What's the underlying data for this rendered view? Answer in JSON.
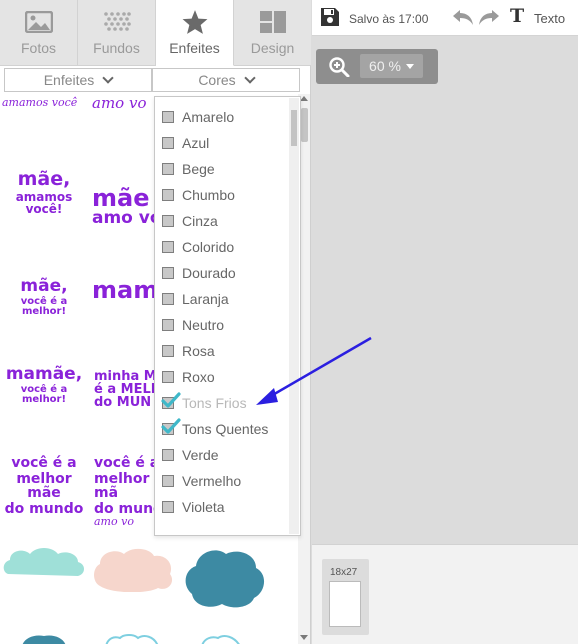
{
  "tabs": [
    {
      "label": "Fotos",
      "icon": "image-icon"
    },
    {
      "label": "Fundos",
      "icon": "pattern-icon"
    },
    {
      "label": "Enfeites",
      "icon": "star-icon",
      "active": true
    },
    {
      "label": "Design",
      "icon": "layout-icon"
    }
  ],
  "filters": {
    "category": "Enfeites",
    "color": "Cores"
  },
  "color_options": [
    {
      "label": "Amarelo",
      "checked": false
    },
    {
      "label": "Azul",
      "checked": false
    },
    {
      "label": "Bege",
      "checked": false
    },
    {
      "label": "Chumbo",
      "checked": false
    },
    {
      "label": "Cinza",
      "checked": false
    },
    {
      "label": "Colorido",
      "checked": false
    },
    {
      "label": "Dourado",
      "checked": false
    },
    {
      "label": "Laranja",
      "checked": false
    },
    {
      "label": "Neutro",
      "checked": false
    },
    {
      "label": "Rosa",
      "checked": false
    },
    {
      "label": "Roxo",
      "checked": false
    },
    {
      "label": "Tons Frios",
      "checked": true,
      "disabled": true
    },
    {
      "label": "Tons Quentes",
      "checked": true
    },
    {
      "label": "Verde",
      "checked": false
    },
    {
      "label": "Vermelho",
      "checked": false
    },
    {
      "label": "Violeta",
      "checked": false
    }
  ],
  "stickers": {
    "row0_a": "amamos você",
    "row0_b": "amo vo",
    "row1_a1": "mãe,",
    "row1_a2": "amamos você!",
    "row1_b1": "mãe",
    "row1_b2": "amo vo",
    "row2_a1": "mãe,",
    "row2_a2": "você é a melhor!",
    "row2_b": "mamã",
    "row3_a1": "mamãe,",
    "row3_a2": "você é a melhor!",
    "row3_b1": "minha M",
    "row3_b2": "é a MELH",
    "row3_b3": "do MUN",
    "row4_a1": "você é a",
    "row4_a2": "melhor mãe",
    "row4_a3": "do mundo",
    "row4_b1": "você é a",
    "row4_b2": "melhor mã",
    "row4_b3": "do mund",
    "row4_b4": "amo vo"
  },
  "toolbar": {
    "saved_text": "Salvo às 17:00",
    "text_tool_label": "Texto"
  },
  "zoom": {
    "value": "60 %"
  },
  "pages": [
    {
      "label": "18x27"
    }
  ],
  "colors": {
    "accent_purple": "#8a22d9",
    "check_teal": "#3fb8c9",
    "arrow_blue": "#2b1fe0",
    "cloud_mint": "#9fe0d8",
    "cloud_peach": "#f6d6cc",
    "cloud_teal": "#3d8aa3"
  }
}
